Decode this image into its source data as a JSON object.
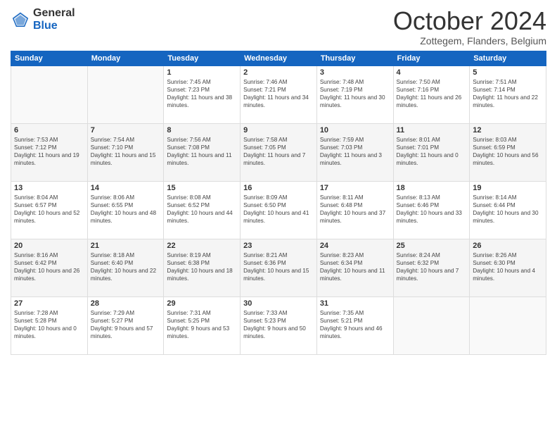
{
  "logo": {
    "general": "General",
    "blue": "Blue"
  },
  "title": "October 2024",
  "location": "Zottegem, Flanders, Belgium",
  "days_of_week": [
    "Sunday",
    "Monday",
    "Tuesday",
    "Wednesday",
    "Thursday",
    "Friday",
    "Saturday"
  ],
  "weeks": [
    [
      {
        "day": "",
        "sunrise": "",
        "sunset": "",
        "daylight": ""
      },
      {
        "day": "",
        "sunrise": "",
        "sunset": "",
        "daylight": ""
      },
      {
        "day": "1",
        "sunrise": "Sunrise: 7:45 AM",
        "sunset": "Sunset: 7:23 PM",
        "daylight": "Daylight: 11 hours and 38 minutes."
      },
      {
        "day": "2",
        "sunrise": "Sunrise: 7:46 AM",
        "sunset": "Sunset: 7:21 PM",
        "daylight": "Daylight: 11 hours and 34 minutes."
      },
      {
        "day": "3",
        "sunrise": "Sunrise: 7:48 AM",
        "sunset": "Sunset: 7:19 PM",
        "daylight": "Daylight: 11 hours and 30 minutes."
      },
      {
        "day": "4",
        "sunrise": "Sunrise: 7:50 AM",
        "sunset": "Sunset: 7:16 PM",
        "daylight": "Daylight: 11 hours and 26 minutes."
      },
      {
        "day": "5",
        "sunrise": "Sunrise: 7:51 AM",
        "sunset": "Sunset: 7:14 PM",
        "daylight": "Daylight: 11 hours and 22 minutes."
      }
    ],
    [
      {
        "day": "6",
        "sunrise": "Sunrise: 7:53 AM",
        "sunset": "Sunset: 7:12 PM",
        "daylight": "Daylight: 11 hours and 19 minutes."
      },
      {
        "day": "7",
        "sunrise": "Sunrise: 7:54 AM",
        "sunset": "Sunset: 7:10 PM",
        "daylight": "Daylight: 11 hours and 15 minutes."
      },
      {
        "day": "8",
        "sunrise": "Sunrise: 7:56 AM",
        "sunset": "Sunset: 7:08 PM",
        "daylight": "Daylight: 11 hours and 11 minutes."
      },
      {
        "day": "9",
        "sunrise": "Sunrise: 7:58 AM",
        "sunset": "Sunset: 7:05 PM",
        "daylight": "Daylight: 11 hours and 7 minutes."
      },
      {
        "day": "10",
        "sunrise": "Sunrise: 7:59 AM",
        "sunset": "Sunset: 7:03 PM",
        "daylight": "Daylight: 11 hours and 3 minutes."
      },
      {
        "day": "11",
        "sunrise": "Sunrise: 8:01 AM",
        "sunset": "Sunset: 7:01 PM",
        "daylight": "Daylight: 11 hours and 0 minutes."
      },
      {
        "day": "12",
        "sunrise": "Sunrise: 8:03 AM",
        "sunset": "Sunset: 6:59 PM",
        "daylight": "Daylight: 10 hours and 56 minutes."
      }
    ],
    [
      {
        "day": "13",
        "sunrise": "Sunrise: 8:04 AM",
        "sunset": "Sunset: 6:57 PM",
        "daylight": "Daylight: 10 hours and 52 minutes."
      },
      {
        "day": "14",
        "sunrise": "Sunrise: 8:06 AM",
        "sunset": "Sunset: 6:55 PM",
        "daylight": "Daylight: 10 hours and 48 minutes."
      },
      {
        "day": "15",
        "sunrise": "Sunrise: 8:08 AM",
        "sunset": "Sunset: 6:52 PM",
        "daylight": "Daylight: 10 hours and 44 minutes."
      },
      {
        "day": "16",
        "sunrise": "Sunrise: 8:09 AM",
        "sunset": "Sunset: 6:50 PM",
        "daylight": "Daylight: 10 hours and 41 minutes."
      },
      {
        "day": "17",
        "sunrise": "Sunrise: 8:11 AM",
        "sunset": "Sunset: 6:48 PM",
        "daylight": "Daylight: 10 hours and 37 minutes."
      },
      {
        "day": "18",
        "sunrise": "Sunrise: 8:13 AM",
        "sunset": "Sunset: 6:46 PM",
        "daylight": "Daylight: 10 hours and 33 minutes."
      },
      {
        "day": "19",
        "sunrise": "Sunrise: 8:14 AM",
        "sunset": "Sunset: 6:44 PM",
        "daylight": "Daylight: 10 hours and 30 minutes."
      }
    ],
    [
      {
        "day": "20",
        "sunrise": "Sunrise: 8:16 AM",
        "sunset": "Sunset: 6:42 PM",
        "daylight": "Daylight: 10 hours and 26 minutes."
      },
      {
        "day": "21",
        "sunrise": "Sunrise: 8:18 AM",
        "sunset": "Sunset: 6:40 PM",
        "daylight": "Daylight: 10 hours and 22 minutes."
      },
      {
        "day": "22",
        "sunrise": "Sunrise: 8:19 AM",
        "sunset": "Sunset: 6:38 PM",
        "daylight": "Daylight: 10 hours and 18 minutes."
      },
      {
        "day": "23",
        "sunrise": "Sunrise: 8:21 AM",
        "sunset": "Sunset: 6:36 PM",
        "daylight": "Daylight: 10 hours and 15 minutes."
      },
      {
        "day": "24",
        "sunrise": "Sunrise: 8:23 AM",
        "sunset": "Sunset: 6:34 PM",
        "daylight": "Daylight: 10 hours and 11 minutes."
      },
      {
        "day": "25",
        "sunrise": "Sunrise: 8:24 AM",
        "sunset": "Sunset: 6:32 PM",
        "daylight": "Daylight: 10 hours and 7 minutes."
      },
      {
        "day": "26",
        "sunrise": "Sunrise: 8:26 AM",
        "sunset": "Sunset: 6:30 PM",
        "daylight": "Daylight: 10 hours and 4 minutes."
      }
    ],
    [
      {
        "day": "27",
        "sunrise": "Sunrise: 7:28 AM",
        "sunset": "Sunset: 5:28 PM",
        "daylight": "Daylight: 10 hours and 0 minutes."
      },
      {
        "day": "28",
        "sunrise": "Sunrise: 7:29 AM",
        "sunset": "Sunset: 5:27 PM",
        "daylight": "Daylight: 9 hours and 57 minutes."
      },
      {
        "day": "29",
        "sunrise": "Sunrise: 7:31 AM",
        "sunset": "Sunset: 5:25 PM",
        "daylight": "Daylight: 9 hours and 53 minutes."
      },
      {
        "day": "30",
        "sunrise": "Sunrise: 7:33 AM",
        "sunset": "Sunset: 5:23 PM",
        "daylight": "Daylight: 9 hours and 50 minutes."
      },
      {
        "day": "31",
        "sunrise": "Sunrise: 7:35 AM",
        "sunset": "Sunset: 5:21 PM",
        "daylight": "Daylight: 9 hours and 46 minutes."
      },
      {
        "day": "",
        "sunrise": "",
        "sunset": "",
        "daylight": ""
      },
      {
        "day": "",
        "sunrise": "",
        "sunset": "",
        "daylight": ""
      }
    ]
  ]
}
